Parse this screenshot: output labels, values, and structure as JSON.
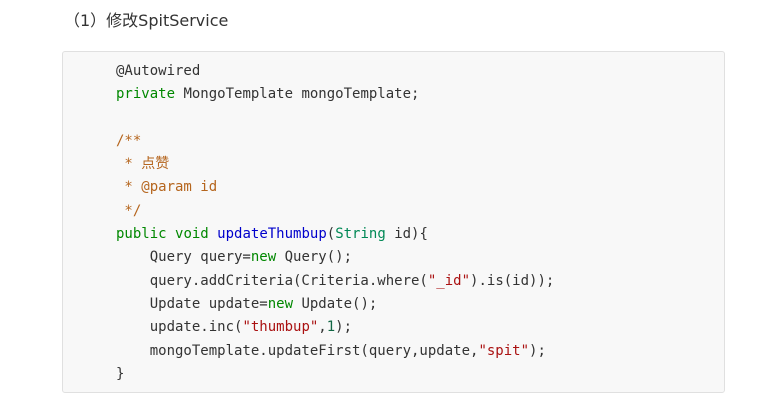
{
  "heading": "（1）修改SpitService",
  "code_lines": [
    [
      {
        "t": "@Autowired",
        "k": "plain"
      }
    ],
    [
      {
        "t": "private",
        "k": "keyword"
      },
      {
        "t": " MongoTemplate mongoTemplate;",
        "k": "plain"
      }
    ],
    [],
    [
      {
        "t": "/**",
        "k": "comment"
      }
    ],
    [
      {
        "t": " * 点赞",
        "k": "comment"
      }
    ],
    [
      {
        "t": " * @param id",
        "k": "comment"
      }
    ],
    [
      {
        "t": " */",
        "k": "comment"
      }
    ],
    [
      {
        "t": "public",
        "k": "keyword"
      },
      {
        "t": " ",
        "k": "plain"
      },
      {
        "t": "void",
        "k": "keyword"
      },
      {
        "t": " ",
        "k": "plain"
      },
      {
        "t": "updateThumbup",
        "k": "method"
      },
      {
        "t": "(",
        "k": "plain"
      },
      {
        "t": "String",
        "k": "type"
      },
      {
        "t": " id){",
        "k": "plain"
      }
    ],
    [
      {
        "t": "    Query query=",
        "k": "plain"
      },
      {
        "t": "new",
        "k": "keyword"
      },
      {
        "t": " Query();",
        "k": "plain"
      }
    ],
    [
      {
        "t": "    query.addCriteria(Criteria.where(",
        "k": "plain"
      },
      {
        "t": "\"_id\"",
        "k": "string"
      },
      {
        "t": ").is(id));",
        "k": "plain"
      }
    ],
    [
      {
        "t": "    Update update=",
        "k": "plain"
      },
      {
        "t": "new",
        "k": "keyword"
      },
      {
        "t": " Update();",
        "k": "plain"
      }
    ],
    [
      {
        "t": "    update.inc(",
        "k": "plain"
      },
      {
        "t": "\"thumbup\"",
        "k": "string"
      },
      {
        "t": ",",
        "k": "plain"
      },
      {
        "t": "1",
        "k": "number"
      },
      {
        "t": ");",
        "k": "plain"
      }
    ],
    [
      {
        "t": "    mongoTemplate.updateFirst(query,update,",
        "k": "plain"
      },
      {
        "t": "\"spit\"",
        "k": "string"
      },
      {
        "t": ");",
        "k": "plain"
      }
    ],
    [
      {
        "t": "}",
        "k": "plain"
      }
    ]
  ]
}
